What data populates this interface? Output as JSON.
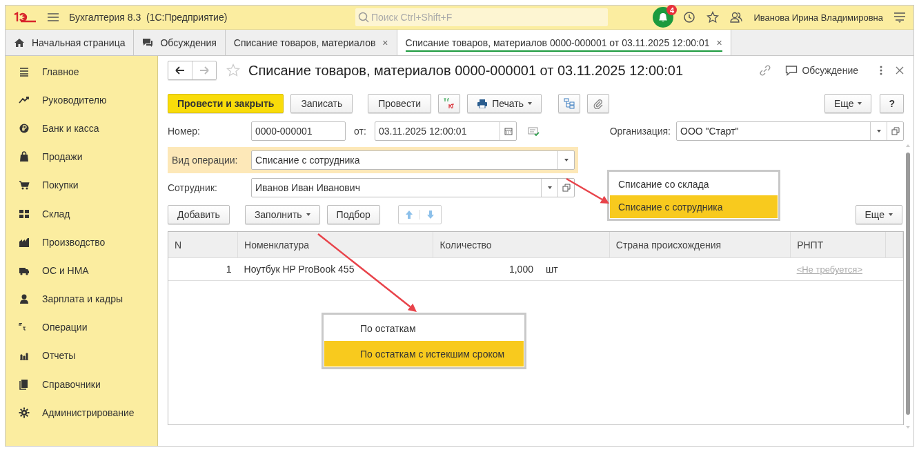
{
  "app": {
    "title": "Бухгалтерия 8.3  (1С:Предприятие)",
    "search": {
      "placeholder": "Поиск Ctrl+Shift+F"
    },
    "notifications": "4",
    "user": "Иванова Ирина Владимировна"
  },
  "tabs": [
    {
      "label": "Начальная страница",
      "selected": false
    },
    {
      "label": "Обсуждения",
      "selected": false
    },
    {
      "label": "Списание товаров, материалов",
      "selected": false,
      "close": "×"
    },
    {
      "label": "Списание товаров, материалов 0000-000001 от 03.11.2025 12:00:01",
      "selected": true,
      "close": "×"
    }
  ],
  "sidebar": {
    "items": [
      {
        "label": "Главное"
      },
      {
        "label": "Руководителю"
      },
      {
        "label": "Банк и касса"
      },
      {
        "label": "Продажи"
      },
      {
        "label": "Покупки"
      },
      {
        "label": "Склад"
      },
      {
        "label": "Производство"
      },
      {
        "label": "ОС и НМА"
      },
      {
        "label": "Зарплата и кадры"
      },
      {
        "label": "Операции"
      },
      {
        "label": "Отчеты"
      },
      {
        "label": "Справочники"
      },
      {
        "label": "Администрирование"
      }
    ]
  },
  "document": {
    "title": "Списание товаров, материалов 0000-000001 от 03.11.2025 12:00:01",
    "discussion": "Обсуждение",
    "toolbar": [
      {
        "label": "Провести и закрыть",
        "kind": "primary"
      },
      {
        "label": "Записать",
        "kind": "plain"
      },
      {
        "label": "Провести",
        "kind": "plain"
      },
      {
        "label": "Печать",
        "kind": "print"
      }
    ],
    "more": "Еще",
    "help": "?",
    "number": {
      "label": "Номер:",
      "value": "0000-000001"
    },
    "date": {
      "label": "от:",
      "value": "03.11.2025 12:00:01"
    },
    "organization": {
      "label": "Организация:",
      "value": "ООО \"Старт\""
    },
    "operation": {
      "label": "Вид операции:",
      "value": "Списание с сотрудника"
    },
    "employee": {
      "label": "Сотрудник:",
      "value": "Иванов Иван Иванович"
    },
    "table_toolbar": [
      {
        "label": "Добавить",
        "dropdown": false
      },
      {
        "label": "Заполнить",
        "dropdown": true
      },
      {
        "label": "Подбор",
        "dropdown": false
      }
    ],
    "table_more": "Еще",
    "table": {
      "columns": [
        "N",
        "Номенклатура",
        "Количество",
        "Страна происхождения",
        "РНПТ"
      ],
      "rows": [
        {
          "n": "1",
          "name": "Ноутбук HP ProBook 455",
          "quantity": "1,000",
          "unit": "шт",
          "rnpt": "<Не требуется>"
        }
      ]
    }
  },
  "operation_menu": {
    "items": [
      {
        "label": "Списание со склада",
        "selected": false
      },
      {
        "label": "Списание с сотрудника",
        "selected": true
      }
    ]
  },
  "fill_menu": {
    "items": [
      {
        "label": "По остаткам",
        "selected": false
      },
      {
        "label": "По остаткам с истекшим сроком",
        "selected": true
      }
    ]
  }
}
